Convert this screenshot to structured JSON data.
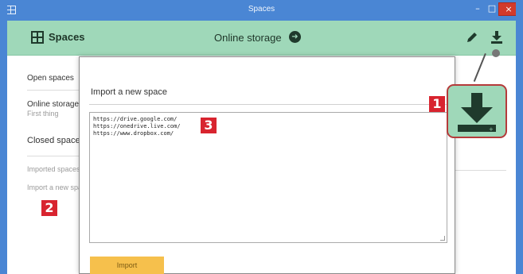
{
  "window": {
    "title": "Spaces",
    "minimize_symbol": "–",
    "maximize_symbol": "□",
    "close_symbol": "×"
  },
  "header": {
    "spaces_label": "Spaces",
    "center_label": "Online storage",
    "icons": [
      "spaces-grid-icon",
      "arrow-circle-icon",
      "pencil-icon",
      "download-icon"
    ],
    "background_color": "#9fd8b9"
  },
  "sidebar": {
    "open_spaces": "Open spaces",
    "online_storage": "Online storage",
    "first_thing": "First thing",
    "closed_spaces": "Closed spaces",
    "imported_spaces": "Imported spaces",
    "import_new": "Import a new space"
  },
  "dialog": {
    "title": "Import a new space",
    "urls": [
      "https://drive.google.com/",
      "https://onedrive.live.com/",
      "https://www.dropbox.com/"
    ],
    "import_button": "Import",
    "button_color": "#f6c04c"
  },
  "badges": {
    "one": "1",
    "two": "2",
    "three": "3",
    "color": "#d8242f"
  }
}
